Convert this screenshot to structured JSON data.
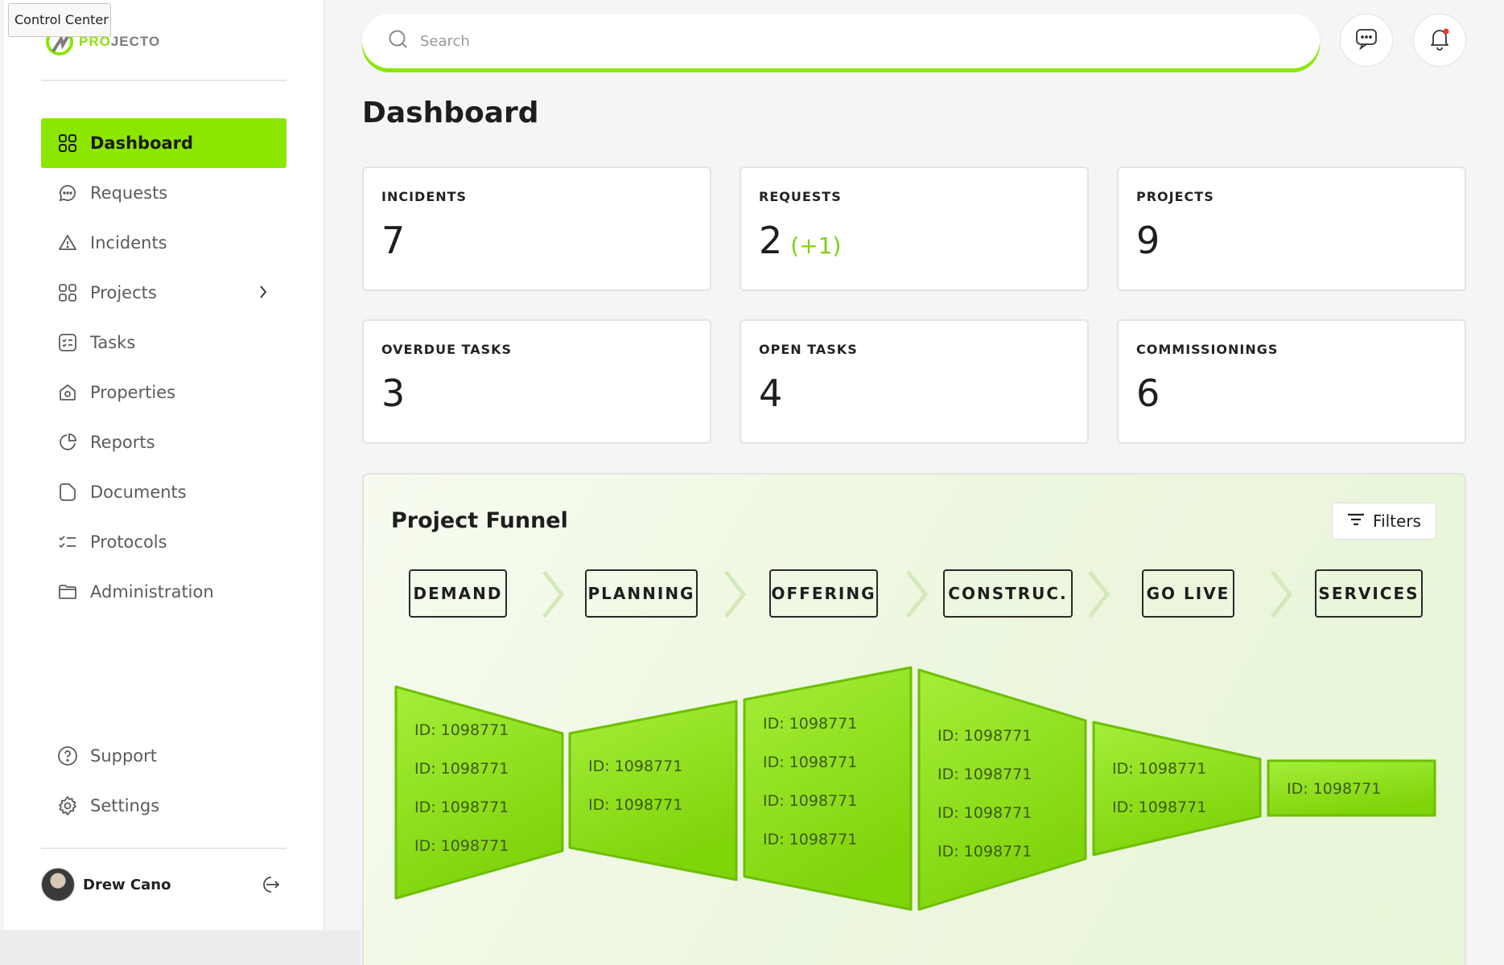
{
  "tooltip": "Control Center",
  "logo": {
    "brand_green": "PRO",
    "brand_gray": "JECTO"
  },
  "nav": {
    "items": [
      {
        "label": "Dashboard",
        "icon": "grid-icon",
        "active": true
      },
      {
        "label": "Requests",
        "icon": "chat-bubble-icon"
      },
      {
        "label": "Incidents",
        "icon": "warning-icon"
      },
      {
        "label": "Projects",
        "icon": "grid-icon",
        "has_submenu": true
      },
      {
        "label": "Tasks",
        "icon": "checklist-icon"
      },
      {
        "label": "Properties",
        "icon": "house-icon"
      },
      {
        "label": "Reports",
        "icon": "pie-chart-icon"
      },
      {
        "label": "Documents",
        "icon": "document-icon"
      },
      {
        "label": "Protocols",
        "icon": "list-check-icon"
      },
      {
        "label": "Administration",
        "icon": "folder-icon"
      }
    ],
    "bottom": [
      {
        "label": "Support",
        "icon": "help-icon"
      },
      {
        "label": "Settings",
        "icon": "gear-icon"
      }
    ]
  },
  "user": {
    "name": "Drew Cano"
  },
  "search": {
    "placeholder": "Search"
  },
  "page": {
    "title": "Dashboard"
  },
  "stats": [
    {
      "label": "INCIDENTS",
      "value": "7"
    },
    {
      "label": "REQUESTS",
      "value": "2",
      "delta": "(+1)"
    },
    {
      "label": "PROJECTS",
      "value": "9"
    },
    {
      "label": "OVERDUE TASKS",
      "value": "3"
    },
    {
      "label": "OPEN TASKS",
      "value": "4"
    },
    {
      "label": "COMMISSIONINGS",
      "value": "6"
    }
  ],
  "funnel": {
    "title": "Project Funnel",
    "filters_label": "Filters",
    "stages": [
      "DEMAND",
      "PLANNING",
      "OFFERING",
      "CONSTRUC.",
      "GO LIVE",
      "SERVICES"
    ],
    "columns": [
      {
        "ids": [
          "ID: 1098771",
          "ID: 1098771",
          "ID: 1098771",
          "ID: 1098771"
        ]
      },
      {
        "ids": [
          "ID: 1098771",
          "ID: 1098771"
        ]
      },
      {
        "ids": [
          "ID: 1098771",
          "ID: 1098771",
          "ID: 1098771",
          "ID: 1098771"
        ]
      },
      {
        "ids": [
          "ID: 1098771",
          "ID: 1098771",
          "ID: 1098771",
          "ID: 1098771"
        ]
      },
      {
        "ids": [
          "ID: 1098771",
          "ID: 1098771"
        ]
      },
      {
        "ids": [
          "ID: 1098771"
        ]
      }
    ]
  },
  "colors": {
    "accent": "#8be600",
    "accent_dark": "#6fc400",
    "delta": "#7fd012",
    "notification_dot": "#e53935"
  }
}
